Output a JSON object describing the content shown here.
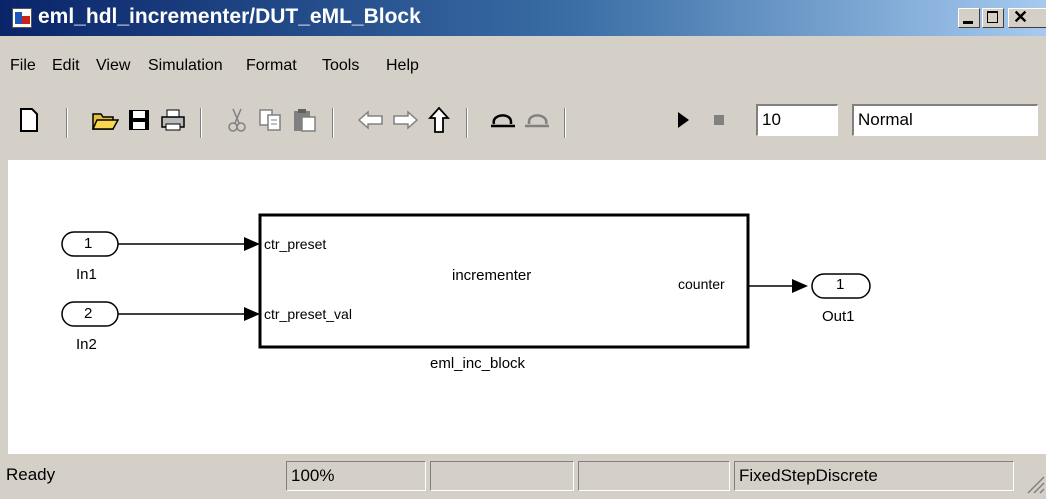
{
  "window": {
    "title": "eml_hdl_incrementer/DUT_eML_Block",
    "icon": "simulink-model-icon",
    "buttons": {
      "minimize": "minimize-icon",
      "maximize": "maximize-icon",
      "close": "close-icon"
    }
  },
  "menu": [
    "File",
    "Edit",
    "View",
    "Simulation",
    "Format",
    "Tools",
    "Help"
  ],
  "toolbar": {
    "buttons": [
      "new-model-icon",
      "open-folder-icon",
      "save-icon",
      "print-icon",
      "cut-icon",
      "copy-icon",
      "paste-icon",
      "back-arrow-icon",
      "forward-arrow-icon",
      "up-arrow-icon",
      "undo-icon",
      "redo-icon",
      "start-simulation-icon",
      "stop-simulation-icon"
    ],
    "stop_time": "10",
    "sim_mode": "Normal"
  },
  "diagram": {
    "inports": [
      {
        "number": "1",
        "name": "In1"
      },
      {
        "number": "2",
        "name": "In2"
      }
    ],
    "block": {
      "title": "incrementer",
      "inputs": [
        "ctr_preset",
        "ctr_preset_val"
      ],
      "output": "counter",
      "name": "eml_inc_block"
    },
    "outport": {
      "number": "1",
      "name": "Out1"
    }
  },
  "status": {
    "text": "Ready",
    "zoom": "100%",
    "pane3": "",
    "pane4": "",
    "solver": "FixedStepDiscrete"
  }
}
